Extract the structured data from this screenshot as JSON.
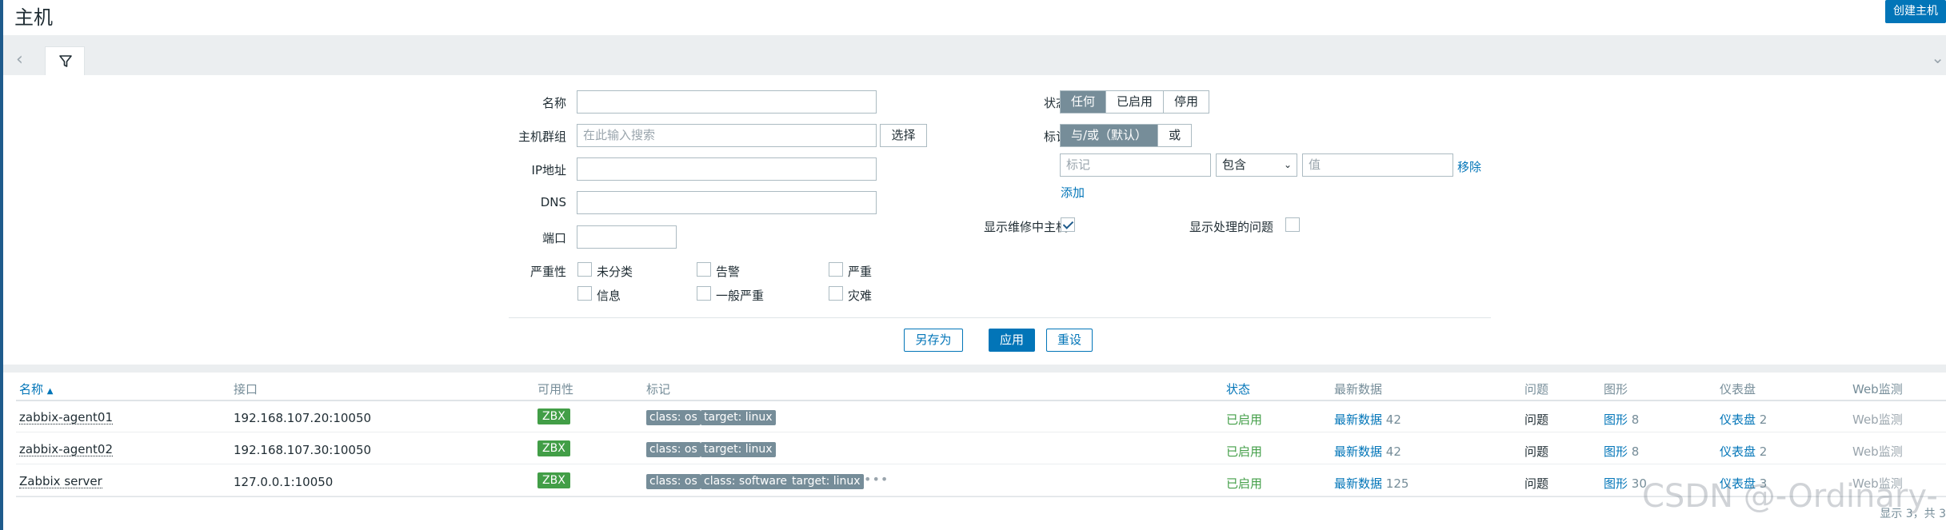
{
  "page": {
    "title": "主机",
    "create_button": "创建主机"
  },
  "filter": {
    "labels": {
      "name": "名称",
      "host_groups": "主机群组",
      "ip": "IP地址",
      "dns": "DNS",
      "port": "端口",
      "severity": "严重性",
      "status": "状态",
      "tags": "标记",
      "show_maintenance": "显示维修中主机",
      "show_suppressed": "显示处理的问题"
    },
    "host_groups_placeholder": "在此输入搜索",
    "select_button": "选择",
    "status_options": [
      "任何",
      "已启用",
      "停用"
    ],
    "status_selected": "任何",
    "tag_mode_options": [
      "与/或（默认）",
      "或"
    ],
    "tag_mode_selected": "与/或（默认）",
    "tag_row": {
      "tag_placeholder": "标记",
      "operator": "包含",
      "value_placeholder": "值",
      "remove": "移除"
    },
    "add_link": "添加",
    "show_maintenance_checked": true,
    "show_suppressed_checked": false,
    "severities": [
      {
        "label": "未分类",
        "checked": false
      },
      {
        "label": "告警",
        "checked": false
      },
      {
        "label": "严重",
        "checked": false
      },
      {
        "label": "信息",
        "checked": false
      },
      {
        "label": "一般严重",
        "checked": false
      },
      {
        "label": "灾难",
        "checked": false
      }
    ],
    "buttons": {
      "save_as": "另存为",
      "apply": "应用",
      "reset": "重设"
    }
  },
  "table": {
    "columns": {
      "name": "名称",
      "interface": "接口",
      "availability": "可用性",
      "tags": "标记",
      "status": "状态",
      "latest": "最新数据",
      "problems": "问题",
      "graphs": "图形",
      "dashboards": "仪表盘",
      "web": "Web监测"
    },
    "sort_indicator": "▲",
    "rows": [
      {
        "name": "zabbix-agent01",
        "interface": "192.168.107.20:10050",
        "availability": "ZBX",
        "tags": [
          "class: os",
          "target: linux"
        ],
        "status": "已启用",
        "latest_label": "最新数据",
        "latest_count": "42",
        "problems": "问题",
        "graphs_label": "图形",
        "graphs_count": "8",
        "dash_label": "仪表盘",
        "dash_count": "2",
        "web": "Web监测"
      },
      {
        "name": "zabbix-agent02",
        "interface": "192.168.107.30:10050",
        "availability": "ZBX",
        "tags": [
          "class: os",
          "target: linux"
        ],
        "status": "已启用",
        "latest_label": "最新数据",
        "latest_count": "42",
        "problems": "问题",
        "graphs_label": "图形",
        "graphs_count": "8",
        "dash_label": "仪表盘",
        "dash_count": "2",
        "web": "Web监测"
      },
      {
        "name": "Zabbix server",
        "interface": "127.0.0.1:10050",
        "availability": "ZBX",
        "tags": [
          "class: os",
          "class: software",
          "target: linux"
        ],
        "more_tags": "•••",
        "status": "已启用",
        "latest_label": "最新数据",
        "latest_count": "125",
        "problems": "问题",
        "graphs_label": "图形",
        "graphs_count": "30",
        "dash_label": "仪表盘",
        "dash_count": "3",
        "web": "Web监测"
      }
    ],
    "footer": "显示 3，共 3"
  },
  "watermark": "CSDN @-Ordinary-",
  "colors": {
    "accent": "#0275b8",
    "enabled": "#429e47",
    "tag_bg": "#768d99",
    "panel_bg": "#ebeef0",
    "left_stripe": "#1f5b8c"
  }
}
